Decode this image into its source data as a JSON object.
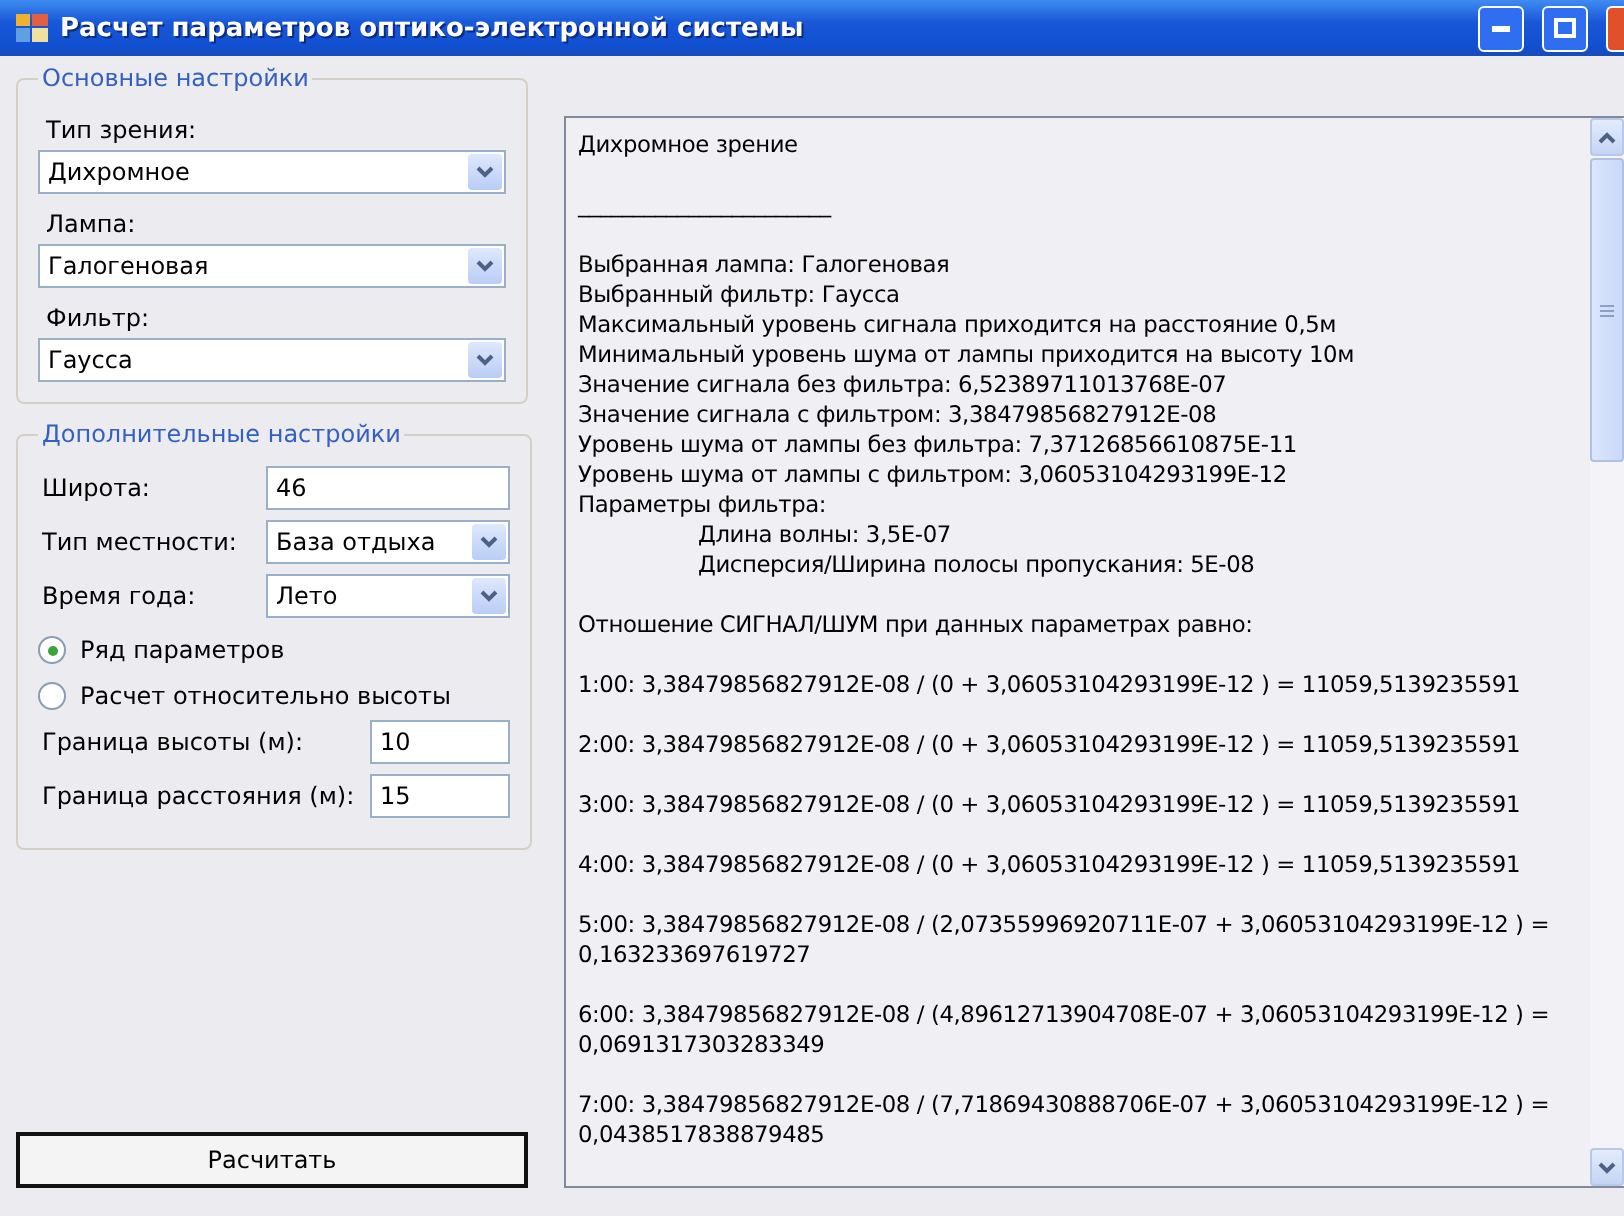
{
  "window": {
    "title": "Расчет параметров оптико-электронной системы"
  },
  "main_settings": {
    "title": "Основные настройки",
    "fields": [
      {
        "label": "Тип зрения:",
        "value": "Дихромное"
      },
      {
        "label": "Лампа:",
        "value": "Галогеновая"
      },
      {
        "label": "Фильтр:",
        "value": "Гаусса"
      }
    ]
  },
  "extra_settings": {
    "title": "Дополнительные настройки",
    "rows": [
      {
        "kind": "text",
        "label": "Широта:",
        "value": "46"
      },
      {
        "kind": "select",
        "label": "Тип местности:",
        "value": "База отдыха"
      },
      {
        "kind": "select",
        "label": "Время года:",
        "value": "Лето"
      }
    ],
    "modes": [
      {
        "label": "Ряд параметров",
        "selected": true
      },
      {
        "label": "Расчет относительно высоты",
        "selected": false
      }
    ],
    "limits": [
      {
        "label": "Граница высоты (м):",
        "value": "10"
      },
      {
        "label": "Граница расстояния (м):",
        "value": "15"
      }
    ]
  },
  "calculate_button": "Расчитать",
  "output": [
    {
      "kind": "line",
      "text": "Дихромное зрение"
    },
    {
      "kind": "gap"
    },
    {
      "kind": "line",
      "text": "_______________________"
    },
    {
      "kind": "gap"
    },
    {
      "kind": "line",
      "text": "Выбранная лампа: Галогеновая"
    },
    {
      "kind": "line",
      "text": "Выбранный фильтр: Гаусса"
    },
    {
      "kind": "line",
      "text": "Максимальный уровень сигнала приходится на расстояние 0,5м"
    },
    {
      "kind": "line",
      "text": "Минимальный уровень шума от лампы приходится на высоту 10м"
    },
    {
      "kind": "line",
      "text": "Значение сигнала без фильтра: 6,52389711013768E-07"
    },
    {
      "kind": "line",
      "text": "Значение сигнала с фильтром: 3,38479856827912E-08"
    },
    {
      "kind": "line",
      "text": "Уровень шума от лампы без фильтра: 7,37126856610875E-11"
    },
    {
      "kind": "line",
      "text": "Уровень шума от лампы с фильтром: 3,06053104293199E-12"
    },
    {
      "kind": "line",
      "text": "Параметры фильтра:"
    },
    {
      "kind": "indented",
      "text": "Длина волны: 3,5E-07"
    },
    {
      "kind": "indented",
      "text": "Дисперсия/Ширина полосы пропускания: 5E-08"
    },
    {
      "kind": "gap"
    },
    {
      "kind": "line",
      "text": "Отношение СИГНАЛ/ШУМ при данных параметрах равно:"
    },
    {
      "kind": "gap"
    },
    {
      "kind": "line",
      "text": "1:00: 3,38479856827912E-08 / (0 + 3,06053104293199E-12 ) = 11059,5139235591"
    },
    {
      "kind": "gap"
    },
    {
      "kind": "line",
      "text": "2:00: 3,38479856827912E-08 / (0 + 3,06053104293199E-12 ) = 11059,5139235591"
    },
    {
      "kind": "gap"
    },
    {
      "kind": "line",
      "text": "3:00: 3,38479856827912E-08 / (0 + 3,06053104293199E-12 ) = 11059,5139235591"
    },
    {
      "kind": "gap"
    },
    {
      "kind": "line",
      "text": "4:00: 3,38479856827912E-08 / (0 + 3,06053104293199E-12 ) = 11059,5139235591"
    },
    {
      "kind": "gap"
    },
    {
      "kind": "line",
      "text": "5:00: 3,38479856827912E-08 / (2,07355996920711E-07 + 3,06053104293199E-12 ) = 0,163233697619727"
    },
    {
      "kind": "gap"
    },
    {
      "kind": "line",
      "text": "6:00: 3,38479856827912E-08 / (4,89612713904708E-07 + 3,06053104293199E-12 ) = 0,0691317303283349"
    },
    {
      "kind": "gap"
    },
    {
      "kind": "line",
      "text": "7:00: 3,38479856827912E-08 / (7,71869430888706E-07 + 3,06053104293199E-12 ) = 0,0438517838879485"
    }
  ]
}
